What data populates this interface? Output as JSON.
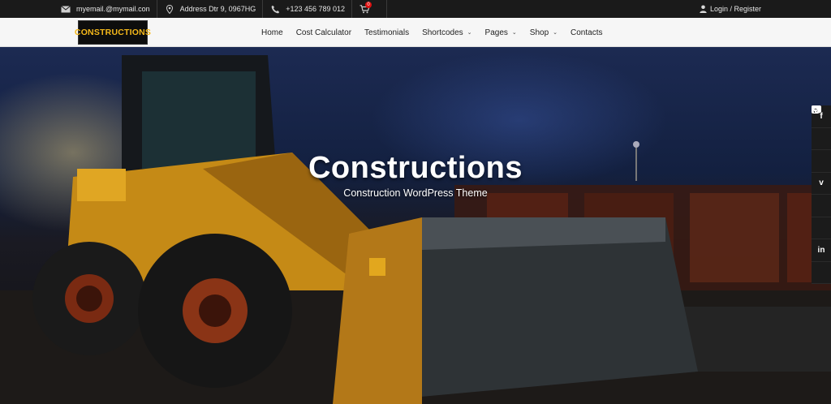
{
  "topbar": {
    "email": "myemail.@mymail.con",
    "address": "Address Dtr 9, 0967HG",
    "phone": "+123 456 789 012",
    "cart_count": "0",
    "login": "Login / Register"
  },
  "brand": {
    "logo_text": "CONSTRUCTIONS",
    "logo_color": "#f6b91a"
  },
  "nav": {
    "items": [
      {
        "label": "Home"
      },
      {
        "label": "Cost Calculator"
      },
      {
        "label": "Testimonials"
      },
      {
        "label": "Shortcodes"
      },
      {
        "label": "Pages"
      },
      {
        "label": "Shop"
      },
      {
        "label": "Contacts"
      }
    ]
  },
  "hero": {
    "title": "Constructions",
    "subtitle": "Construction WordPress Theme"
  },
  "social": [
    "facebook-icon",
    "twitter-icon",
    "youtube-icon",
    "vimeo-icon",
    "pinterest-icon",
    "instagram-icon",
    "linkedin-icon",
    "rss-icon"
  ]
}
